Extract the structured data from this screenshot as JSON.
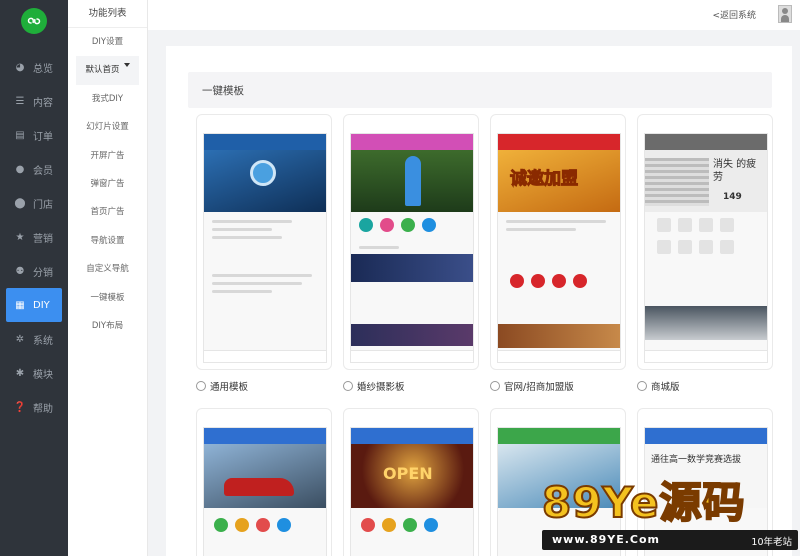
{
  "sidebar": {
    "items": [
      {
        "label": "总览",
        "icon": "pie-chart-icon"
      },
      {
        "label": "内容",
        "icon": "list-icon"
      },
      {
        "label": "订单",
        "icon": "document-icon"
      },
      {
        "label": "会员",
        "icon": "user-icon"
      },
      {
        "label": "门店",
        "icon": "map-pin-icon"
      },
      {
        "label": "营销",
        "icon": "star-icon"
      },
      {
        "label": "分销",
        "icon": "users-icon"
      },
      {
        "label": "DIY",
        "icon": "layout-icon",
        "active": true
      },
      {
        "label": "系统",
        "icon": "gear-icon"
      },
      {
        "label": "模块",
        "icon": "puzzle-icon"
      },
      {
        "label": "帮助",
        "icon": "help-icon"
      }
    ]
  },
  "submenu": {
    "title": "功能列表",
    "items": [
      "DIY设置",
      "默认首页",
      "我式DIY",
      "幻灯片设置",
      "开屏广告",
      "弹窗广告",
      "首页广告",
      "导航设置",
      "自定义导航",
      "一键模板",
      "DIY布局"
    ]
  },
  "header": {
    "back_label": "<返回系统"
  },
  "main": {
    "section_title": "一键模板",
    "templates": [
      {
        "label": "通用模板",
        "color": "#1f5fa8"
      },
      {
        "label": "婚纱摄影板",
        "color": "#d24fb6"
      },
      {
        "label": "官网/招商加盟版",
        "color": "#d7262b"
      },
      {
        "label": "商城版",
        "color": "#6b6b6b"
      },
      {
        "label": "",
        "color": "#2f6fd0"
      },
      {
        "label": "",
        "color": "#2f6fd0"
      },
      {
        "label": "",
        "color": "#3ca64a"
      },
      {
        "label": "",
        "color": "#2f6fd0"
      }
    ]
  },
  "template_texts": {
    "zhaoshang": "诚邀加盟",
    "shop": "消失 的疲劳",
    "price": "149",
    "open": "OPEN",
    "math": "通往高一数学竞赛选拔"
  },
  "watermark": {
    "logo": "89Ye源码",
    "url": "www.89YE.Com",
    "tag": "10年老站"
  }
}
